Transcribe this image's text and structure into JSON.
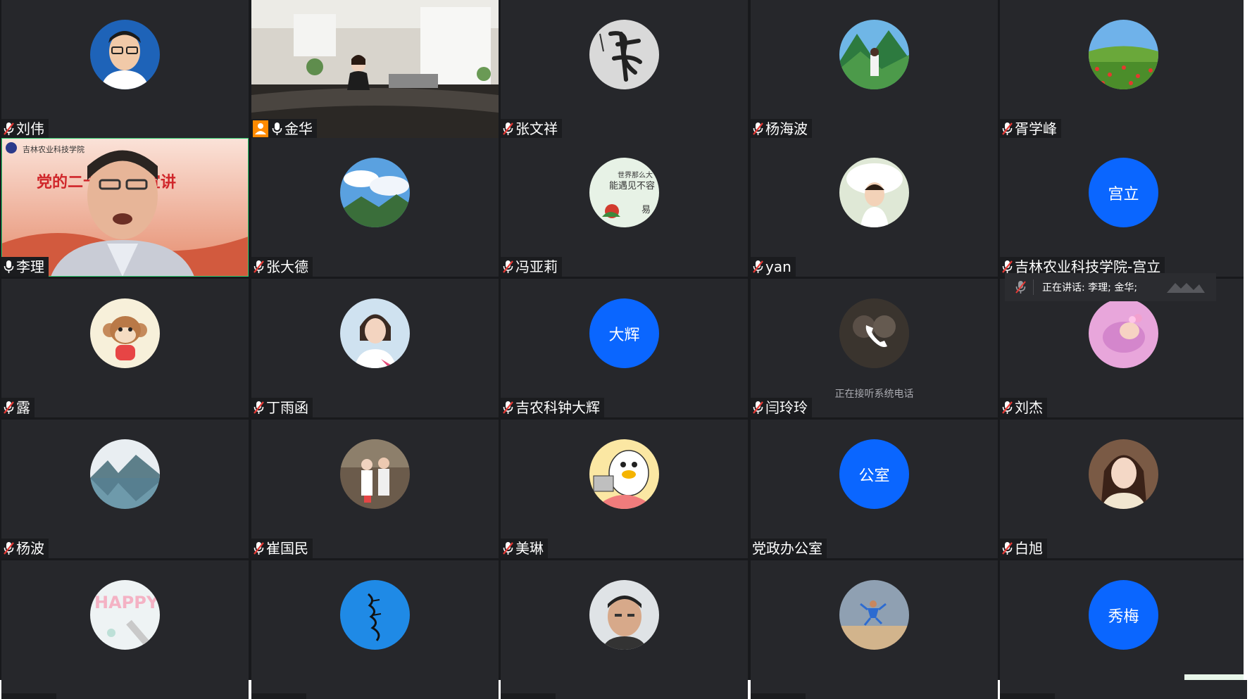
{
  "participants": [
    {
      "name": "刘伟",
      "mic": "muted",
      "avatar": "person-glasses-photo"
    },
    {
      "name": "金华",
      "mic": "on",
      "video": "classroom-lecturer",
      "host": true
    },
    {
      "name": "张文祥",
      "mic": "muted",
      "avatar": "calligraphy-image"
    },
    {
      "name": "杨海波",
      "mic": "muted",
      "avatar": "mountain-person-photo"
    },
    {
      "name": "胥学峰",
      "mic": "muted",
      "avatar": "flower-field-photo"
    },
    {
      "name": "李理",
      "mic": "on",
      "video": "speaker-with-banner",
      "banner_text": "党的二十大精神宣讲",
      "banner_org": "吉林农业科技学院"
    },
    {
      "name": "张大德",
      "mic": "muted",
      "avatar": "sky-mountain-photo"
    },
    {
      "name": "冯亚莉",
      "mic": "muted",
      "avatar": "text-flower-image",
      "avatar_text": "世界那么大 能遇见不容易"
    },
    {
      "name": "yan",
      "mic": "muted",
      "avatar": "child-photo"
    },
    {
      "name": "吉林农业科技学院-宫立",
      "mic": "muted",
      "initials": "宫立"
    },
    {
      "name": "露",
      "mic": "muted",
      "avatar": "cartoon-monkey"
    },
    {
      "name": "丁雨函",
      "mic": "muted",
      "avatar": "woman-photo"
    },
    {
      "name": "吉农科钟大辉",
      "mic": "muted",
      "initials": "大辉"
    },
    {
      "name": "闫玲玲",
      "mic": "muted",
      "avatar": "phone-call",
      "status": "正在接听系统电话"
    },
    {
      "name": "刘杰",
      "mic": "muted",
      "avatar": "baby-photo"
    },
    {
      "name": "杨波",
      "mic": "muted",
      "avatar": "lake-photo"
    },
    {
      "name": "崔国民",
      "mic": "muted",
      "avatar": "couple-photo"
    },
    {
      "name": "美琳",
      "mic": "muted",
      "avatar": "cartoon-duck"
    },
    {
      "name": "党政办公室",
      "mic": "none",
      "initials": "公室"
    },
    {
      "name": "白旭",
      "mic": "muted",
      "avatar": "woman-portrait"
    },
    {
      "name": "",
      "mic": "",
      "avatar": "happy-image"
    },
    {
      "name": "",
      "mic": "",
      "avatar": "mongolian-script-blue"
    },
    {
      "name": "",
      "mic": "",
      "avatar": "man-photo"
    },
    {
      "name": "",
      "mic": "",
      "avatar": "jumping-person-photo"
    },
    {
      "name": "",
      "mic": "",
      "initials": "秀梅"
    }
  ],
  "speaking_bar": {
    "text": "正在讲话: 李理; 金华;"
  },
  "colors": {
    "tile_bg": "#26272b",
    "grid_gap": "#18191c",
    "initials_blue": "#0a66ff",
    "muted_red": "#e53935",
    "active_green": "#2ecc71"
  }
}
